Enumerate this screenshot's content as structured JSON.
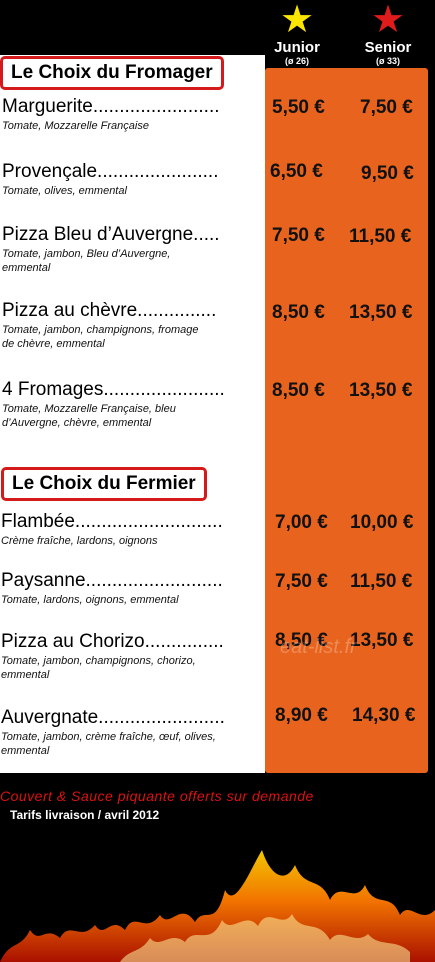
{
  "columns": {
    "junior": {
      "label": "Junior",
      "size": "(ø 26)",
      "star_color": "#ffe600"
    },
    "senior": {
      "label": "Senior",
      "size": "(ø 33)",
      "star_color": "#e01b1b"
    }
  },
  "sections": [
    {
      "title": "Le Choix du Fromager"
    },
    {
      "title": "Le Choix du Fermier"
    }
  ],
  "items": [
    {
      "name": "Marguerite........................",
      "desc": "Tomate, Mozzarelle Française",
      "junior": "5,50 €",
      "senior": "7,50 €"
    },
    {
      "name": "Provençale.......................",
      "desc": "Tomate, olives, emmental",
      "junior": "6,50 €",
      "senior": "9,50 €"
    },
    {
      "name": "Pizza Bleu d’Auvergne.....",
      "desc": "Tomate, jambon, Bleu d’Auvergne, emmental",
      "junior": "7,50 €",
      "senior": "11,50 €"
    },
    {
      "name": "Pizza au chèvre...............",
      "desc": "Tomate, jambon, champignons, fromage de chèvre, emmental",
      "junior": "8,50 €",
      "senior": "13,50 €"
    },
    {
      "name": "4 Fromages.......................",
      "desc": "Tomate, Mozzarelle Française, bleu d’Auvergne, chèvre, emmental",
      "junior": "8,50 €",
      "senior": "13,50 €"
    },
    {
      "name": "Flambée............................",
      "desc": "Crème fraîche, lardons, oignons",
      "junior": "7,00 €",
      "senior": "10,00 €"
    },
    {
      "name": "Paysanne..........................",
      "desc": "Tomate, lardons, oignons, emmental",
      "junior": "7,50 €",
      "senior": "11,50 €"
    },
    {
      "name": "Pizza au Chorizo...............",
      "desc": "Tomate, jambon, champignons, chorizo, emmental",
      "junior": "8,50 €",
      "senior": "13,50 €"
    },
    {
      "name": "Auvergnate........................",
      "desc": "Tomate, jambon, crème fraîche, œuf, olives, emmental",
      "junior": "8,90 €",
      "senior": "14,30 €"
    }
  ],
  "footer": {
    "offer": "Couvert & Sauce piquante offerts sur demande",
    "tarifs": "Tarifs livraison / avril 2012"
  },
  "watermark": "eat-list.fr",
  "colors": {
    "accent_orange": "#e8641e",
    "section_border": "#d41a1a"
  }
}
